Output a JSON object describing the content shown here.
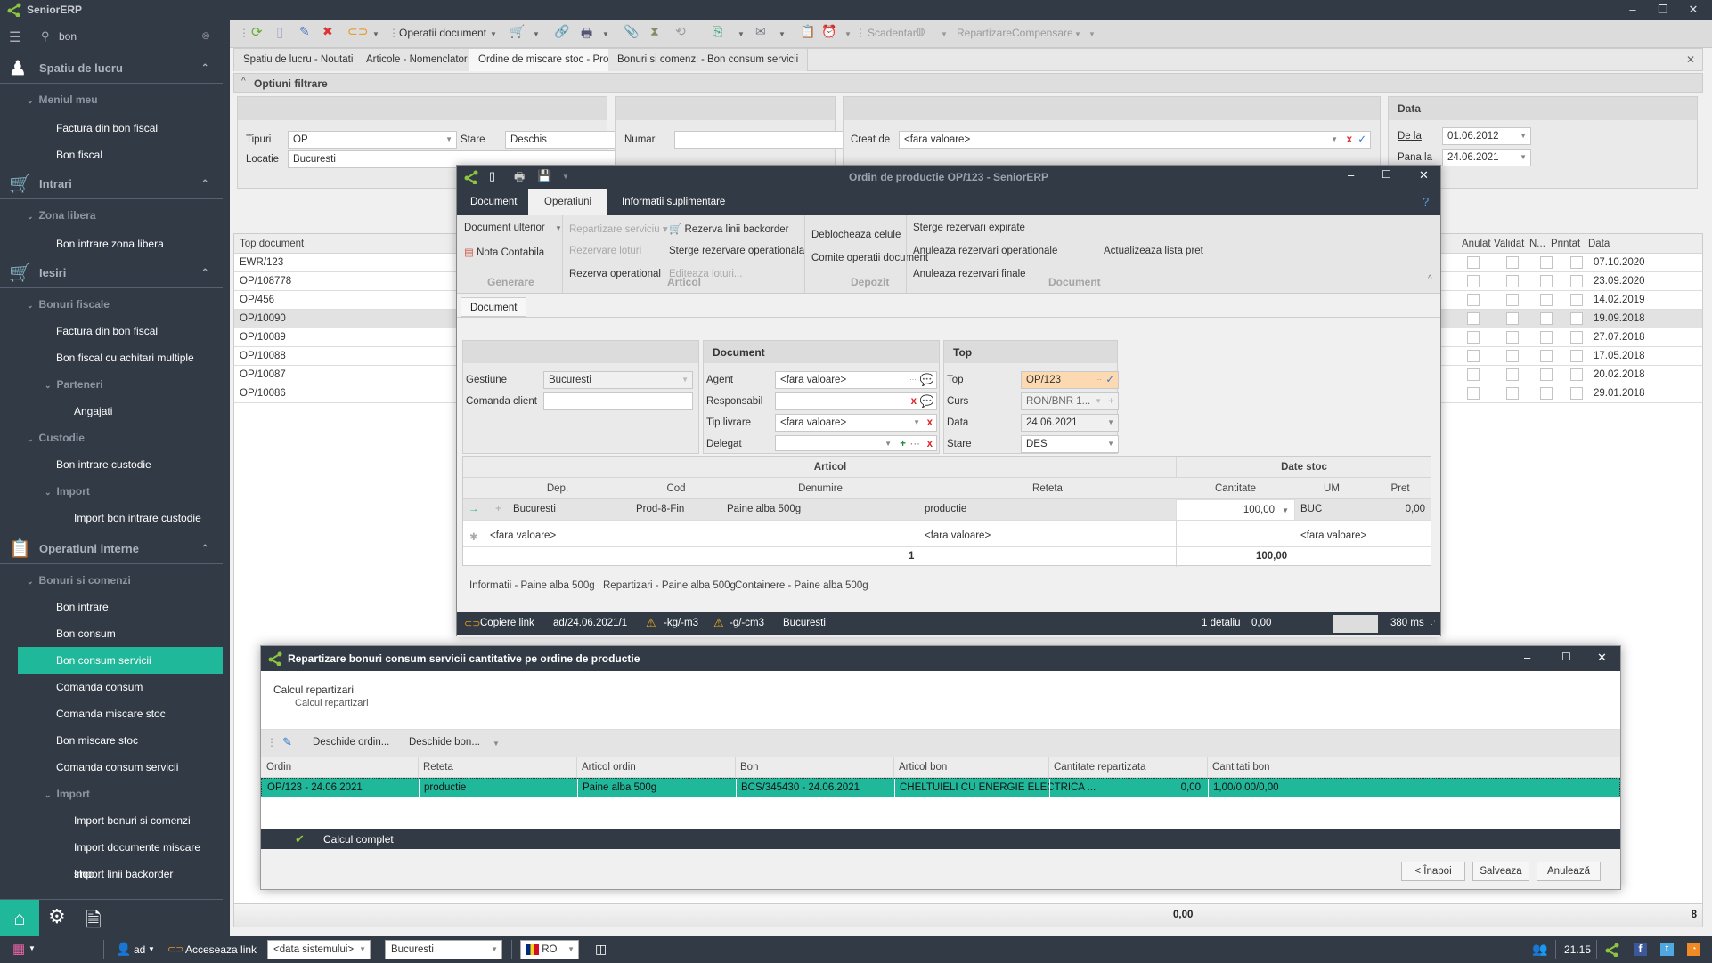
{
  "app": {
    "title": "SeniorERP"
  },
  "sidebar": {
    "search_value": "bon",
    "sections": [
      {
        "label": "Spatiu de lucru"
      },
      {
        "label": "Intrari"
      },
      {
        "label": "Iesiri"
      },
      {
        "label": "Operatiuni interne"
      }
    ],
    "groups": {
      "meniul_meu": "Meniul meu",
      "zona_libera": "Zona libera",
      "bonuri_fiscale": "Bonuri fiscale",
      "parteneri": "Parteneri",
      "custodie": "Custodie",
      "import1": "Import",
      "bonuri_si_comenzi": "Bonuri si comenzi",
      "import2": "Import"
    },
    "items": {
      "factura1": "Factura din bon fiscal",
      "bon_fiscal": "Bon fiscal",
      "bon_intrare_zona": "Bon intrare zona libera",
      "factura2": "Factura din bon fiscal",
      "bon_fiscal_multiple": "Bon fiscal cu achitari multiple",
      "angajati": "Angajati",
      "bon_intrare_custodie": "Bon intrare custodie",
      "import_bon_custodie": "Import bon intrare custodie",
      "bon_intrare": "Bon intrare",
      "bon_consum": "Bon consum",
      "bon_consum_servicii": "Bon consum servicii",
      "comanda_consum": "Comanda consum",
      "comanda_miscare_stoc": "Comanda miscare stoc",
      "bon_miscare_stoc": "Bon miscare stoc",
      "comanda_consum_servicii": "Comanda consum servicii",
      "import_bonuri_comenzi": "Import bonuri si comenzi",
      "import_documente_miscare": "Import documente miscare stoc",
      "import_linii_backorder": "Import linii backorder"
    }
  },
  "toolbar": {
    "operatii_document": "Operatii document",
    "scadentar": "Scadentar",
    "repartizare": "Repartizare",
    "compensare": "Compensare"
  },
  "tabs": [
    {
      "label": "Spatiu de lucru - Noutati"
    },
    {
      "label": "Articole - Nomenclator"
    },
    {
      "label": "Ordine de miscare stoc - Productie"
    },
    {
      "label": "Bonuri si comenzi - Bon consum servicii"
    }
  ],
  "filters": {
    "title": "Optiuni filtrare",
    "tipuri_label": "Tipuri",
    "tipuri_value": "OP",
    "stare_label": "Stare",
    "stare_value": "Deschis",
    "locatie_label": "Locatie",
    "locatie_value": "Bucuresti",
    "numar_label": "Numar",
    "numar_value": "",
    "creat_de_label": "Creat de",
    "creat_de_value": "<fara valoare>",
    "data_title": "Data",
    "de_la_label": "De la",
    "de_la_value": "01.06.2012",
    "pana_la_label": "Pana la",
    "pana_la_value": "24.06.2021"
  },
  "list": {
    "col_top_document": "Top document",
    "col_anulat": "Anulat",
    "col_validat": "Validat",
    "col_n": "N...",
    "col_printat": "Printat",
    "col_data": "Data",
    "rows": [
      {
        "doc": "EWR/123",
        "data": "07.10.2020"
      },
      {
        "doc": "OP/108778",
        "data": "23.09.2020"
      },
      {
        "doc": "OP/456",
        "data": "14.02.2019"
      },
      {
        "doc": "OP/10090",
        "data": "19.09.2018"
      },
      {
        "doc": "OP/10089",
        "data": "27.07.2018"
      },
      {
        "doc": "OP/10088",
        "data": "17.05.2018"
      },
      {
        "doc": "OP/10087",
        "data": "20.02.2018"
      },
      {
        "doc": "OP/10086",
        "data": "29.01.2018"
      }
    ],
    "footer_total": "0,00",
    "footer_count": "8"
  },
  "order_window": {
    "title": "Ordin de productie OP/123 - SeniorERP",
    "ribbon_tabs": [
      "Document",
      "Operatiuni",
      "Informatii suplimentare"
    ],
    "ribbon": {
      "document_ulterior": "Document ulterior",
      "nota_contabila": "Nota Contabila",
      "generare": "Generare",
      "repartizare_serviciu": "Repartizare serviciu",
      "rezervare_loturi": "Rezervare loturi",
      "rezerva_operational": "Rezerva operational",
      "rezerva_linii_backorder": "Rezerva linii backorder",
      "sterge_rezervare_operationala": "Sterge rezervare operationala",
      "editeaza_loturi": "Editeaza loturi...",
      "articol": "Articol",
      "deblocheaza_celule": "Deblocheaza celule",
      "comite_operatii_document": "Comite operatii document",
      "depozit": "Depozit",
      "sterge_rezervari_expirate": "Sterge rezervari expirate",
      "anuleaza_rezervari_operationale": "Anuleaza rezervari operationale",
      "anuleaza_rezervari_finale": "Anuleaza rezervari finale",
      "actualizeaza_lista_pret": "Actualizeaza lista pret",
      "document": "Document"
    },
    "inner_tab": "Document",
    "form": {
      "gestiune_label": "Gestiune",
      "gestiune_value": "Bucuresti",
      "comanda_client_label": "Comanda client",
      "comanda_client_value": "",
      "document_section": "Document",
      "agent_label": "Agent",
      "agent_value": "<fara valoare>",
      "responsabil_label": "Responsabil",
      "responsabil_value": "",
      "tip_livrare_label": "Tip livrare",
      "tip_livrare_value": "<fara valoare>",
      "delegat_label": "Delegat",
      "delegat_value": "",
      "top_section": "Top",
      "top_label": "Top",
      "top_value": "OP/123",
      "curs_label": "Curs",
      "curs_value": "RON/BNR 1...",
      "data_label": "Data",
      "data_value": "24.06.2021",
      "stare_label": "Stare",
      "stare_value": "DES"
    },
    "grid": {
      "band_articol": "Articol",
      "band_date_stoc": "Date stoc",
      "cols": [
        "Dep.",
        "Cod",
        "Denumire",
        "Reteta",
        "Cantitate",
        "UM",
        "Pret"
      ],
      "row": {
        "dep": "Bucuresti",
        "cod": "Prod-8-Fin",
        "denumire": "Paine alba 500g",
        "reteta": "productie",
        "cantitate": "100,00",
        "um": "BUC",
        "pret": "0,00"
      },
      "new_row": {
        "dep": "<fara valoare>",
        "reteta": "<fara valoare>",
        "um": "<fara valoare>"
      },
      "footer_count": "1",
      "footer_total": "100,00"
    },
    "detail_tabs": [
      "Informatii - Paine alba 500g",
      "Repartizari - Paine alba 500g",
      "Containere - Paine alba 500g"
    ],
    "status": {
      "copiere_link": "Copiere link",
      "user_date": "ad/24.06.2021/1",
      "warn1": "-kg/-m3",
      "warn2": "-g/-cm3",
      "location": "Bucuresti",
      "detalii": "1 detaliu",
      "amount": "0,00",
      "timing": "380 ms"
    }
  },
  "wizard": {
    "title": "Repartizare bonuri consum servicii cantitative pe ordine de productie",
    "step_title": "Calcul repartizari",
    "step_subtitle": "Calcul repartizari",
    "toolbar": {
      "deschide_ordin": "Deschide ordin...",
      "deschide_bon": "Deschide bon..."
    },
    "cols": [
      "Ordin",
      "Reteta",
      "Articol ordin",
      "Bon",
      "Articol bon",
      "Cantitate repartizata",
      "Cantitati bon"
    ],
    "rows": [
      [
        "OP/123 - 24.06.2021",
        "productie",
        "Paine alba 500g",
        "BCS/345430 - 24.06.2021",
        "CHELTUIELI CU ENERGIE ELECTRICA ...",
        "0,00",
        "1,00/0,00/0,00"
      ]
    ],
    "status_text": "Calcul complet",
    "buttons": {
      "back": "< Înapoi",
      "save": "Salveaza",
      "cancel": "Anulează"
    }
  },
  "statusbar": {
    "user": "ad",
    "acceseaza_link": "Acceseaza link",
    "data_sistem": "<data sistemului>",
    "location": "Bucuresti",
    "language": "RO",
    "version": "21.15"
  },
  "colors": {
    "accent": "#20b89a",
    "dark": "#323a45",
    "highlight_input": "#fcd9b0"
  }
}
